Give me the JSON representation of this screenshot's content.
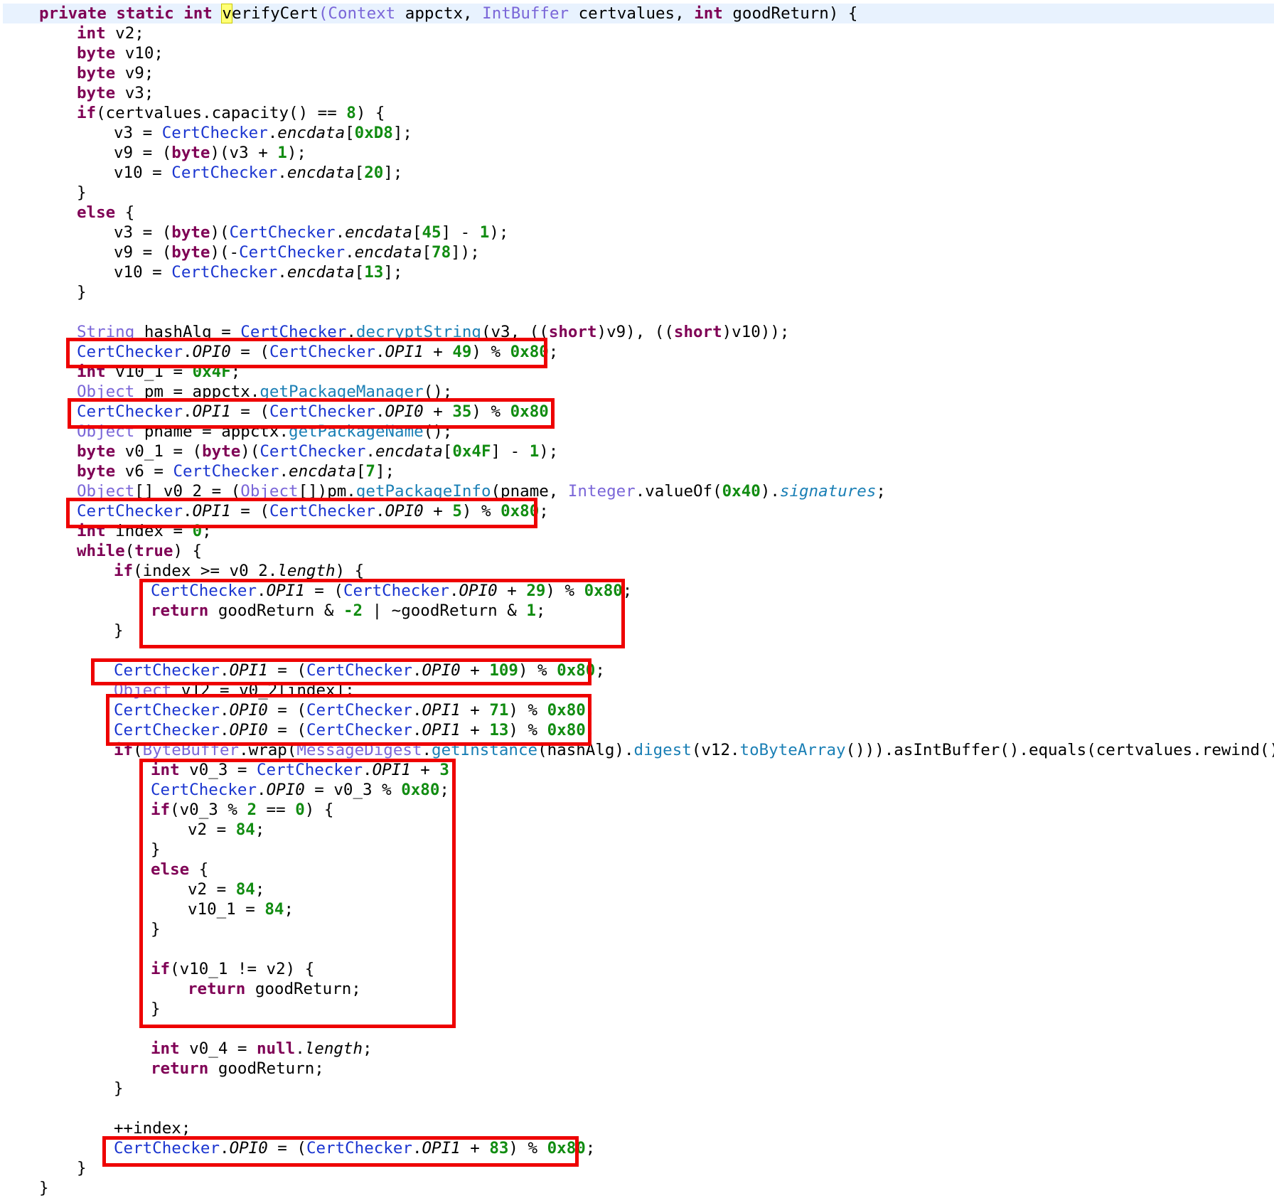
{
  "lines": [
    [
      [
        "kw",
        "private static int "
      ],
      [
        "hl",
        "v"
      ],
      [
        "p",
        "erifyCert"
      ],
      [
        "ty",
        "(Context"
      ],
      [
        "p",
        " appctx, "
      ],
      [
        "ty",
        "IntBuffer"
      ],
      [
        "p",
        " certvalues, "
      ],
      [
        "kw",
        "int"
      ],
      [
        "p",
        " goodReturn) {"
      ]
    ],
    [
      [
        "kw",
        "int"
      ],
      [
        "p",
        " v2;"
      ]
    ],
    [
      [
        "kw",
        "byte"
      ],
      [
        "p",
        " v10;"
      ]
    ],
    [
      [
        "kw",
        "byte"
      ],
      [
        "p",
        " v9;"
      ]
    ],
    [
      [
        "kw",
        "byte"
      ],
      [
        "p",
        " v3;"
      ]
    ],
    [
      [
        "kw",
        "if"
      ],
      [
        "p",
        "(certvalues.capacity() == "
      ],
      [
        "num",
        "8"
      ],
      [
        "p",
        ") {"
      ]
    ],
    [
      [
        "p",
        "v3 = "
      ],
      [
        "cls",
        "CertChecker"
      ],
      [
        "p",
        "."
      ],
      [
        "fld",
        "encdata"
      ],
      [
        "p",
        "["
      ],
      [
        "num",
        "0xD8"
      ],
      [
        "p",
        "];"
      ]
    ],
    [
      [
        "p",
        "v9 = ("
      ],
      [
        "kw",
        "byte"
      ],
      [
        "p",
        ")(v3 + "
      ],
      [
        "num",
        "1"
      ],
      [
        "p",
        ");"
      ]
    ],
    [
      [
        "p",
        "v10 = "
      ],
      [
        "cls",
        "CertChecker"
      ],
      [
        "p",
        "."
      ],
      [
        "fld",
        "encdata"
      ],
      [
        "p",
        "["
      ],
      [
        "num",
        "20"
      ],
      [
        "p",
        "];"
      ]
    ],
    [
      [
        "p",
        "}"
      ]
    ],
    [
      [
        "kw",
        "else"
      ],
      [
        "p",
        " {"
      ]
    ],
    [
      [
        "p",
        "v3 = ("
      ],
      [
        "kw",
        "byte"
      ],
      [
        "p",
        ")("
      ],
      [
        "cls",
        "CertChecker"
      ],
      [
        "p",
        "."
      ],
      [
        "fld",
        "encdata"
      ],
      [
        "p",
        "["
      ],
      [
        "num",
        "45"
      ],
      [
        "p",
        "] - "
      ],
      [
        "num",
        "1"
      ],
      [
        "p",
        ");"
      ]
    ],
    [
      [
        "p",
        "v9 = ("
      ],
      [
        "kw",
        "byte"
      ],
      [
        "p",
        ")(-"
      ],
      [
        "cls",
        "CertChecker"
      ],
      [
        "p",
        "."
      ],
      [
        "fld",
        "encdata"
      ],
      [
        "p",
        "["
      ],
      [
        "num",
        "78"
      ],
      [
        "p",
        "]);"
      ]
    ],
    [
      [
        "p",
        "v10 = "
      ],
      [
        "cls",
        "CertChecker"
      ],
      [
        "p",
        "."
      ],
      [
        "fld",
        "encdata"
      ],
      [
        "p",
        "["
      ],
      [
        "num",
        "13"
      ],
      [
        "p",
        "];"
      ]
    ],
    [
      [
        "p",
        "}"
      ]
    ],
    [],
    [
      [
        "tyd",
        "String"
      ],
      [
        "p",
        " hashAlg = "
      ],
      [
        "cls",
        "CertChecker"
      ],
      [
        "p",
        "."
      ],
      [
        "mth",
        "decryptString"
      ],
      [
        "p",
        "(v3, (("
      ],
      [
        "kw",
        "short"
      ],
      [
        "p",
        ")v9), (("
      ],
      [
        "kw",
        "short"
      ],
      [
        "p",
        ")v10));"
      ]
    ],
    [
      [
        "cls",
        "CertChecker"
      ],
      [
        "p",
        "."
      ],
      [
        "fld",
        "OPI0"
      ],
      [
        "p",
        " = ("
      ],
      [
        "cls",
        "CertChecker"
      ],
      [
        "p",
        "."
      ],
      [
        "fld",
        "OPI1"
      ],
      [
        "p",
        " + "
      ],
      [
        "num",
        "49"
      ],
      [
        "p",
        ") % "
      ],
      [
        "num",
        "0x80"
      ],
      [
        "p",
        ";"
      ]
    ],
    [
      [
        "kw",
        "int"
      ],
      [
        "p",
        " v10_1 = "
      ],
      [
        "num",
        "0x4F"
      ],
      [
        "p",
        ";"
      ]
    ],
    [
      [
        "tyd",
        "Object"
      ],
      [
        "p",
        " pm = appctx."
      ],
      [
        "mth",
        "getPackageManager"
      ],
      [
        "p",
        "();"
      ]
    ],
    [
      [
        "cls",
        "CertChecker"
      ],
      [
        "p",
        "."
      ],
      [
        "fld",
        "OPI1"
      ],
      [
        "p",
        " = ("
      ],
      [
        "cls",
        "CertChecker"
      ],
      [
        "p",
        "."
      ],
      [
        "fld",
        "OPI0"
      ],
      [
        "p",
        " + "
      ],
      [
        "num",
        "35"
      ],
      [
        "p",
        ") % "
      ],
      [
        "num",
        "0x80"
      ],
      [
        "p",
        ";"
      ]
    ],
    [
      [
        "tyd",
        "Object"
      ],
      [
        "p",
        " pname = appctx."
      ],
      [
        "mth",
        "getPackageName"
      ],
      [
        "p",
        "();"
      ]
    ],
    [
      [
        "kw",
        "byte"
      ],
      [
        "p",
        " v0_1 = ("
      ],
      [
        "kw",
        "byte"
      ],
      [
        "p",
        ")("
      ],
      [
        "cls",
        "CertChecker"
      ],
      [
        "p",
        "."
      ],
      [
        "fld",
        "encdata"
      ],
      [
        "p",
        "["
      ],
      [
        "num",
        "0x4F"
      ],
      [
        "p",
        "] - "
      ],
      [
        "num",
        "1"
      ],
      [
        "p",
        ");"
      ]
    ],
    [
      [
        "kw",
        "byte"
      ],
      [
        "p",
        " v6 = "
      ],
      [
        "cls",
        "CertChecker"
      ],
      [
        "p",
        "."
      ],
      [
        "fld",
        "encdata"
      ],
      [
        "p",
        "["
      ],
      [
        "num",
        "7"
      ],
      [
        "p",
        "];"
      ]
    ],
    [
      [
        "tyd",
        "Object"
      ],
      [
        "p",
        "[] v0_2 = ("
      ],
      [
        "tyd",
        "Object"
      ],
      [
        "p",
        "[])pm."
      ],
      [
        "mth",
        "getPackageInfo"
      ],
      [
        "p",
        "(pname, "
      ],
      [
        "ty",
        "Integer"
      ],
      [
        "p",
        ".valueOf("
      ],
      [
        "num",
        "0x40"
      ],
      [
        "p",
        ")."
      ],
      [
        "sig",
        "signatures"
      ],
      [
        "p",
        ";"
      ]
    ],
    [
      [
        "cls",
        "CertChecker"
      ],
      [
        "p",
        "."
      ],
      [
        "fld",
        "OPI1"
      ],
      [
        "p",
        " = ("
      ],
      [
        "cls",
        "CertChecker"
      ],
      [
        "p",
        "."
      ],
      [
        "fld",
        "OPI0"
      ],
      [
        "p",
        " + "
      ],
      [
        "num",
        "5"
      ],
      [
        "p",
        ") % "
      ],
      [
        "num",
        "0x80"
      ],
      [
        "p",
        ";"
      ]
    ],
    [
      [
        "kw",
        "int"
      ],
      [
        "p",
        " index = "
      ],
      [
        "num",
        "0"
      ],
      [
        "p",
        ";"
      ]
    ],
    [
      [
        "kw",
        "while"
      ],
      [
        "p",
        "("
      ],
      [
        "kw",
        "true"
      ],
      [
        "p",
        ") {"
      ]
    ],
    [
      [
        "kw",
        "if"
      ],
      [
        "p",
        "(index >= v0_2."
      ],
      [
        "fld",
        "length"
      ],
      [
        "p",
        ") {"
      ]
    ],
    [
      [
        "cls",
        "CertChecker"
      ],
      [
        "p",
        "."
      ],
      [
        "fld",
        "OPI1"
      ],
      [
        "p",
        " = ("
      ],
      [
        "cls",
        "CertChecker"
      ],
      [
        "p",
        "."
      ],
      [
        "fld",
        "OPI0"
      ],
      [
        "p",
        " + "
      ],
      [
        "num",
        "29"
      ],
      [
        "p",
        ") % "
      ],
      [
        "num",
        "0x80"
      ],
      [
        "p",
        ";"
      ]
    ],
    [
      [
        "kw",
        "return"
      ],
      [
        "p",
        " goodReturn & "
      ],
      [
        "num",
        "-2"
      ],
      [
        "p",
        " | ~goodReturn & "
      ],
      [
        "num",
        "1"
      ],
      [
        "p",
        ";"
      ]
    ],
    [
      [
        "p",
        "}"
      ]
    ],
    [],
    [
      [
        "cls",
        "CertChecker"
      ],
      [
        "p",
        "."
      ],
      [
        "fld",
        "OPI1"
      ],
      [
        "p",
        " = ("
      ],
      [
        "cls",
        "CertChecker"
      ],
      [
        "p",
        "."
      ],
      [
        "fld",
        "OPI0"
      ],
      [
        "p",
        " + "
      ],
      [
        "num",
        "109"
      ],
      [
        "p",
        ") % "
      ],
      [
        "num",
        "0x80"
      ],
      [
        "p",
        ";"
      ]
    ],
    [
      [
        "tyd",
        "Object"
      ],
      [
        "p",
        " v12 = v0_2[index];"
      ]
    ],
    [
      [
        "cls",
        "CertChecker"
      ],
      [
        "p",
        "."
      ],
      [
        "fld",
        "OPI0"
      ],
      [
        "p",
        " = ("
      ],
      [
        "cls",
        "CertChecker"
      ],
      [
        "p",
        "."
      ],
      [
        "fld",
        "OPI1"
      ],
      [
        "p",
        " + "
      ],
      [
        "num",
        "71"
      ],
      [
        "p",
        ") % "
      ],
      [
        "num",
        "0x80"
      ],
      [
        "p",
        ";"
      ]
    ],
    [
      [
        "cls",
        "CertChecker"
      ],
      [
        "p",
        "."
      ],
      [
        "fld",
        "OPI0"
      ],
      [
        "p",
        " = ("
      ],
      [
        "cls",
        "CertChecker"
      ],
      [
        "p",
        "."
      ],
      [
        "fld",
        "OPI1"
      ],
      [
        "p",
        " + "
      ],
      [
        "num",
        "13"
      ],
      [
        "p",
        ") % "
      ],
      [
        "num",
        "0x80"
      ],
      [
        "p",
        ";"
      ]
    ],
    [
      [
        "kw",
        "if"
      ],
      [
        "p",
        "("
      ],
      [
        "tyd",
        "ByteBuffer"
      ],
      [
        "p",
        ".wrap("
      ],
      [
        "tyd",
        "MessageDigest"
      ],
      [
        "p",
        "."
      ],
      [
        "mth",
        "getInstance"
      ],
      [
        "p",
        "(hashAlg)."
      ],
      [
        "mth",
        "digest"
      ],
      [
        "p",
        "(v12."
      ],
      [
        "mth",
        "toByteArray"
      ],
      [
        "p",
        "()))."
      ],
      [
        "p",
        "asIntBuffer().equals(certvalues.rewind())) {"
      ]
    ],
    [
      [
        "kw",
        "int"
      ],
      [
        "p",
        " v0_3 = "
      ],
      [
        "cls",
        "CertChecker"
      ],
      [
        "p",
        "."
      ],
      [
        "fld",
        "OPI1"
      ],
      [
        "p",
        " + "
      ],
      [
        "num",
        "3"
      ],
      [
        "p",
        ";"
      ]
    ],
    [
      [
        "cls",
        "CertChecker"
      ],
      [
        "p",
        "."
      ],
      [
        "fld",
        "OPI0"
      ],
      [
        "p",
        " = v0_3 % "
      ],
      [
        "num",
        "0x80"
      ],
      [
        "p",
        ";"
      ]
    ],
    [
      [
        "kw",
        "if"
      ],
      [
        "p",
        "(v0_3 % "
      ],
      [
        "num",
        "2"
      ],
      [
        "p",
        " == "
      ],
      [
        "num",
        "0"
      ],
      [
        "p",
        ") {"
      ]
    ],
    [
      [
        "p",
        "v2 = "
      ],
      [
        "num",
        "84"
      ],
      [
        "p",
        ";"
      ]
    ],
    [
      [
        "p",
        "}"
      ]
    ],
    [
      [
        "kw",
        "else"
      ],
      [
        "p",
        " {"
      ]
    ],
    [
      [
        "p",
        "v2 = "
      ],
      [
        "num",
        "84"
      ],
      [
        "p",
        ";"
      ]
    ],
    [
      [
        "p",
        "v10_1 = "
      ],
      [
        "num",
        "84"
      ],
      [
        "p",
        ";"
      ]
    ],
    [
      [
        "p",
        "}"
      ]
    ],
    [],
    [
      [
        "kw",
        "if"
      ],
      [
        "p",
        "(v10_1 != v2) {"
      ]
    ],
    [
      [
        "kw",
        "return"
      ],
      [
        "p",
        " goodReturn;"
      ]
    ],
    [
      [
        "p",
        "}"
      ]
    ],
    [],
    [
      [
        "kw",
        "int"
      ],
      [
        "p",
        " v0_4 = "
      ],
      [
        "kw",
        "null"
      ],
      [
        "p",
        "."
      ],
      [
        "fld",
        "length"
      ],
      [
        "p",
        ";"
      ]
    ],
    [
      [
        "kw",
        "return"
      ],
      [
        "p",
        " goodReturn;"
      ]
    ],
    [
      [
        "p",
        "}"
      ]
    ],
    [],
    [
      [
        "p",
        "++index;"
      ]
    ],
    [
      [
        "cls",
        "CertChecker"
      ],
      [
        "p",
        "."
      ],
      [
        "fld",
        "OPI0"
      ],
      [
        "p",
        " = ("
      ],
      [
        "cls",
        "CertChecker"
      ],
      [
        "p",
        "."
      ],
      [
        "fld",
        "OPI1"
      ],
      [
        "p",
        " + "
      ],
      [
        "num",
        "83"
      ],
      [
        "p",
        ") % "
      ],
      [
        "num",
        "0x80"
      ],
      [
        "p",
        ";"
      ]
    ],
    [
      [
        "p",
        "}"
      ]
    ],
    [
      [
        "p",
        "}"
      ]
    ]
  ]
}
